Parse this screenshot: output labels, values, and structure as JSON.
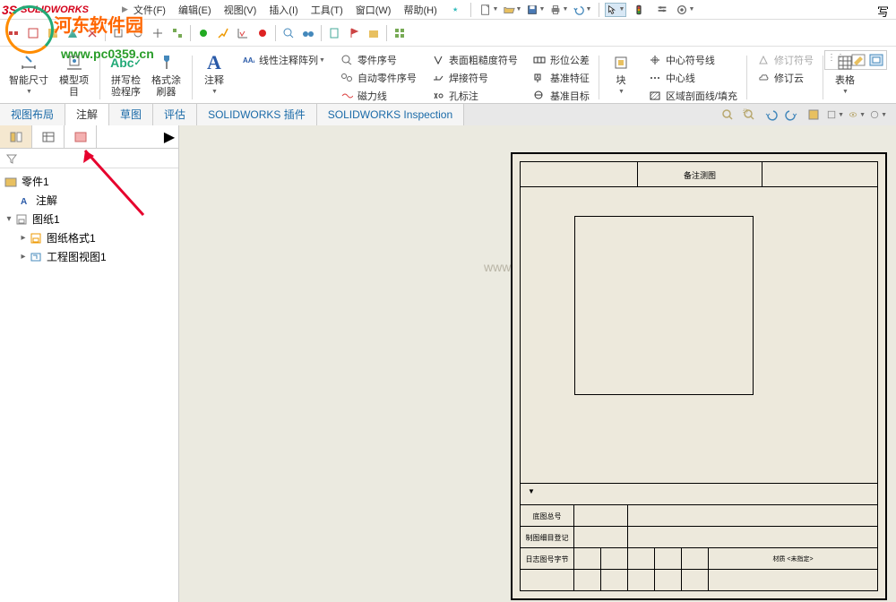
{
  "logo": {
    "icon": "3DS",
    "text": "SOLIDWORKS"
  },
  "watermark": {
    "text": "河东软件园",
    "url": "www.pc0359.cn"
  },
  "menu": {
    "items": [
      "文件(F)",
      "编辑(E)",
      "视图(V)",
      "插入(I)",
      "工具(T)",
      "窗口(W)",
      "帮助(H)"
    ]
  },
  "ribbon": {
    "smart_dim": "智能尺寸",
    "smart_dim2": "",
    "model_items": "模型项\n目",
    "spell_check": "拼写检\n验程序",
    "format_painter": "格式涂\n刷器",
    "note": "注释",
    "linear_pattern": "线性注释阵列",
    "part_number": "零件序号",
    "auto_part_number": "自动零件序号",
    "magnet_line": "磁力线",
    "surface_finish": "表面粗糙度符号",
    "weld_symbol": "焊接符号",
    "hole_callout": "孔标注",
    "geom_tol": "形位公差",
    "datum_feature": "基准特征",
    "datum_target": "基准目标",
    "block": "块",
    "center_mark": "中心符号线",
    "centerline": "中心线",
    "area_hatch": "区域剖面线/填充",
    "rev_symbol": "修订符号",
    "rev_cloud": "修订云",
    "tables": "表格"
  },
  "tabs": [
    "视图布局",
    "注解",
    "草图",
    "评估",
    "SOLIDWORKS 插件",
    "SOLIDWORKS Inspection"
  ],
  "tree": {
    "root": "零件1",
    "annotations": "注解",
    "sheet": "图纸1",
    "sheet_format": "图纸格式1",
    "drawing_view": "工程图视图1"
  },
  "sheet": {
    "header_text": "备注测图",
    "title_label": "材质 <未指定>",
    "spec1": "底图总号",
    "spec2": "制图细目登记",
    "spec3": "日志图号字节"
  },
  "canvas_watermark": "www.gHome.NET",
  "search_char": "写"
}
